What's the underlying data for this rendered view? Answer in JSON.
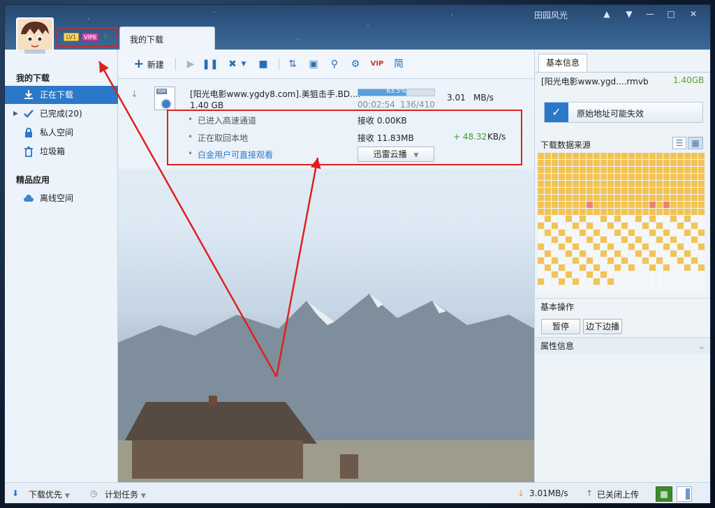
{
  "window": {
    "skin_name": "田园风光",
    "level_badge": "LV1",
    "vip_badge": "VIP6",
    "tab_label": "我的下载"
  },
  "sidebar": {
    "section1": "我的下载",
    "items": [
      {
        "label": "正在下载",
        "active": true,
        "icon": "download-icon"
      },
      {
        "label": "已完成(20)",
        "active": false,
        "icon": "check-icon"
      },
      {
        "label": "私人空间",
        "active": false,
        "icon": "lock-icon"
      },
      {
        "label": "垃圾箱",
        "active": false,
        "icon": "trash-icon"
      }
    ],
    "section2": "精品应用",
    "apps": [
      {
        "label": "离线空间",
        "icon": "cloud-icon"
      }
    ]
  },
  "toolbar": {
    "new_label": "新建",
    "simple_label": "简",
    "vip_label": "VIP"
  },
  "task": {
    "name": "[阳光电影www.ygdy8.com].美狙击手.BD....",
    "size": "1.40 GB",
    "progress": 63.5,
    "progress_text": "63.5%",
    "elapsed": "00:02:54",
    "pieces": "136/410",
    "speed_value": "3.01",
    "speed_unit": "MB/s",
    "file_icon_label": "RM",
    "details": [
      {
        "label": "已进入高速通道",
        "recv": "接收 0.00KB",
        "extra": "",
        "unit": ""
      },
      {
        "label": "正在取回本地",
        "recv": "接收 11.83MB",
        "extra": "+ 48.32",
        "unit": "KB/s"
      },
      {
        "label": "白金用户可直接观看",
        "recv": "",
        "extra": "",
        "unit": ""
      }
    ],
    "play_button": "迅雷云播"
  },
  "right_panel": {
    "tab": "基本信息",
    "file_name": "[阳光电影www.ygd....rmvb",
    "file_size": "1.40GB",
    "source_warning": "原始地址可能失效",
    "sources_title": "下载数据来源",
    "ops_title": "基本操作",
    "pause_btn": "暂停",
    "stream_btn": "边下边播",
    "props_title": "属性信息"
  },
  "statusbar": {
    "priority": "下载优先",
    "schedule": "计划任务",
    "speed": "3.01MB/s",
    "upload": "已关闭上传"
  },
  "colors": {
    "accent": "#2b78c9",
    "piece_done": "#f3c453",
    "piece_active": "#e9827a",
    "piece_empty": "#f5f7f9",
    "highlight": "#e0201c",
    "green_speed": "#3a9a2c"
  }
}
